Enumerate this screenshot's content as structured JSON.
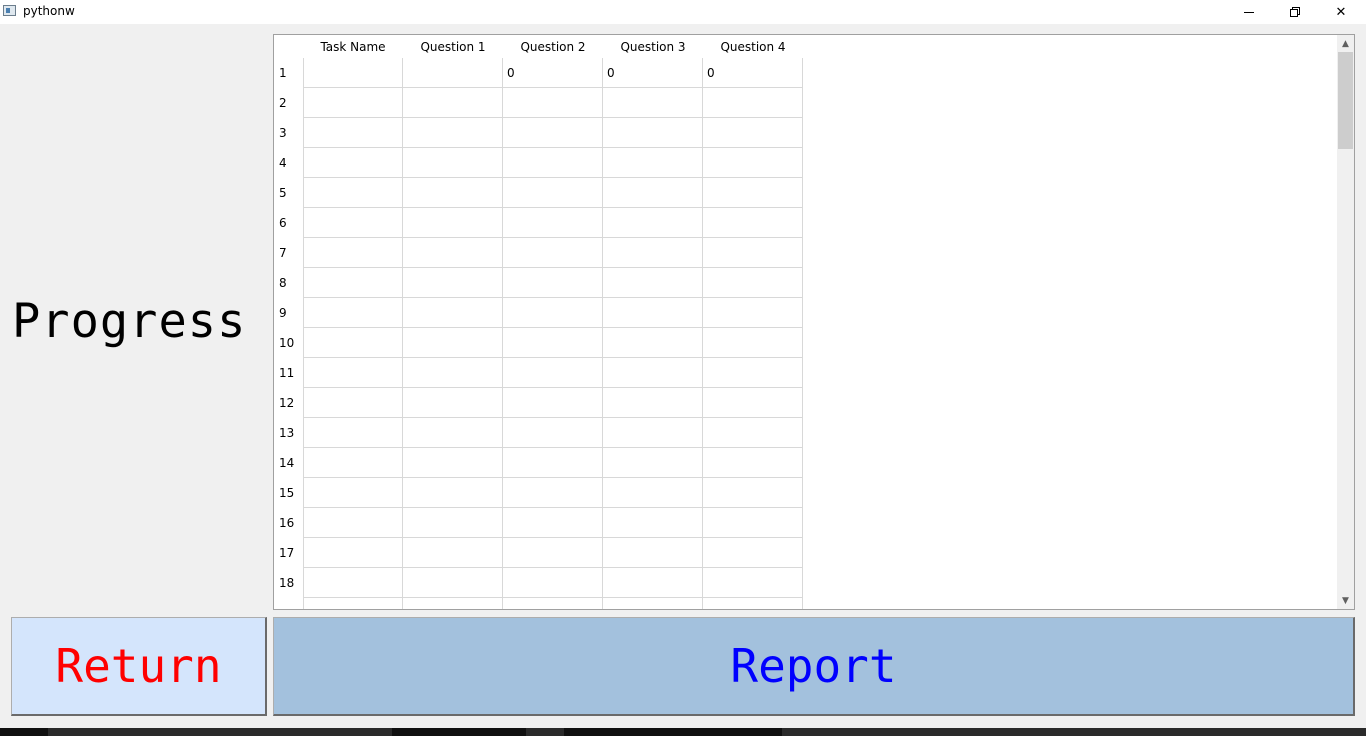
{
  "window": {
    "title": "pythonw",
    "icon": "app-icon",
    "controls": [
      "minimize-icon",
      "restore-icon",
      "close-icon"
    ]
  },
  "heading": "Progress",
  "table": {
    "columns": [
      "Task Name",
      "Question 1",
      "Question 2",
      "Question 3",
      "Question 4"
    ],
    "row_numbers": [
      "1",
      "2",
      "3",
      "4",
      "5",
      "6",
      "7",
      "8",
      "9",
      "10",
      "11",
      "12",
      "13",
      "14",
      "15",
      "16",
      "17",
      "18"
    ],
    "rows": [
      [
        "",
        "",
        "0",
        "0",
        "0"
      ]
    ]
  },
  "buttons": {
    "return_label": "Return",
    "report_label": "Report"
  },
  "colors": {
    "return_bg": "#d4e5fc",
    "return_text": "#ff0000",
    "report_bg": "#a3c1dd",
    "report_text": "#0000ff"
  }
}
